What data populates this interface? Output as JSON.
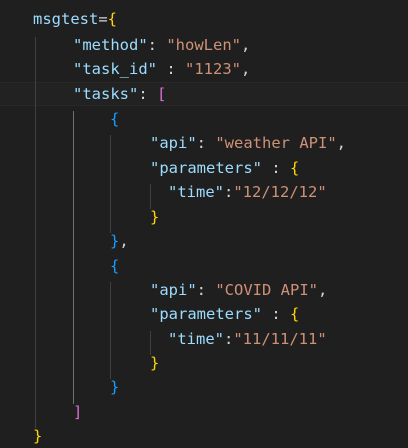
{
  "lines": [
    {
      "tokens": [
        {
          "t": "msgtest",
          "c": "tok-var"
        },
        {
          "t": "=",
          "c": "tok-op"
        },
        {
          "t": "{",
          "c": "b1"
        }
      ]
    },
    {
      "tokens": [
        {
          "t": "\"method\"",
          "c": "tok-key"
        },
        {
          "t": ": ",
          "c": "tok-op"
        },
        {
          "t": "\"howLen\"",
          "c": "tok-str"
        },
        {
          "t": ",",
          "c": "tok-op"
        }
      ]
    },
    {
      "tokens": [
        {
          "t": "\"task_id\"",
          "c": "tok-key"
        },
        {
          "t": " : ",
          "c": "tok-op"
        },
        {
          "t": "\"1123\"",
          "c": "tok-str"
        },
        {
          "t": ",",
          "c": "tok-op"
        }
      ]
    },
    {
      "tokens": [
        {
          "t": "\"tasks\"",
          "c": "tok-key"
        },
        {
          "t": ": ",
          "c": "tok-op"
        },
        {
          "t": "[",
          "c": "b2"
        }
      ]
    },
    {
      "tokens": [
        {
          "t": "{",
          "c": "b3"
        }
      ]
    },
    {
      "tokens": [
        {
          "t": "\"api\"",
          "c": "tok-key"
        },
        {
          "t": ": ",
          "c": "tok-op"
        },
        {
          "t": "\"weather API\"",
          "c": "tok-str"
        },
        {
          "t": ",",
          "c": "tok-op"
        }
      ]
    },
    {
      "tokens": [
        {
          "t": "\"parameters\"",
          "c": "tok-key"
        },
        {
          "t": " : ",
          "c": "tok-op"
        },
        {
          "t": "{",
          "c": "b1"
        }
      ]
    },
    {
      "tokens": [
        {
          "t": "\"time\"",
          "c": "tok-key"
        },
        {
          "t": ":",
          "c": "tok-op"
        },
        {
          "t": "\"12/12/12\"",
          "c": "tok-str"
        }
      ]
    },
    {
      "tokens": [
        {
          "t": "}",
          "c": "b1"
        }
      ]
    },
    {
      "tokens": [
        {
          "t": "}",
          "c": "b3"
        },
        {
          "t": ",",
          "c": "tok-op"
        }
      ]
    },
    {
      "tokens": [
        {
          "t": "{",
          "c": "b3"
        }
      ]
    },
    {
      "tokens": [
        {
          "t": "\"api\"",
          "c": "tok-key"
        },
        {
          "t": ": ",
          "c": "tok-op"
        },
        {
          "t": "\"COVID API\"",
          "c": "tok-str"
        },
        {
          "t": ",",
          "c": "tok-op"
        }
      ]
    },
    {
      "tokens": [
        {
          "t": "\"parameters\"",
          "c": "tok-key"
        },
        {
          "t": " : ",
          "c": "tok-op"
        },
        {
          "t": "{",
          "c": "b1"
        }
      ]
    },
    {
      "tokens": [
        {
          "t": "\"time\"",
          "c": "tok-key"
        },
        {
          "t": ":",
          "c": "tok-op"
        },
        {
          "t": "\"11/11/11\"",
          "c": "tok-str"
        }
      ]
    },
    {
      "tokens": [
        {
          "t": "}",
          "c": "b1"
        }
      ]
    },
    {
      "tokens": [
        {
          "t": "}",
          "c": "b3"
        }
      ]
    },
    {
      "tokens": [
        {
          "t": "]",
          "c": "b2"
        }
      ]
    },
    {
      "tokens": [
        {
          "t": "}",
          "c": "b1"
        }
      ]
    }
  ],
  "colors": {
    "background": "#1f1f1f",
    "variable": "#9cdcfe",
    "string": "#ce9178",
    "bracket_gold": "#ffd700",
    "bracket_orchid": "#da70d6",
    "bracket_blue": "#179fff"
  }
}
